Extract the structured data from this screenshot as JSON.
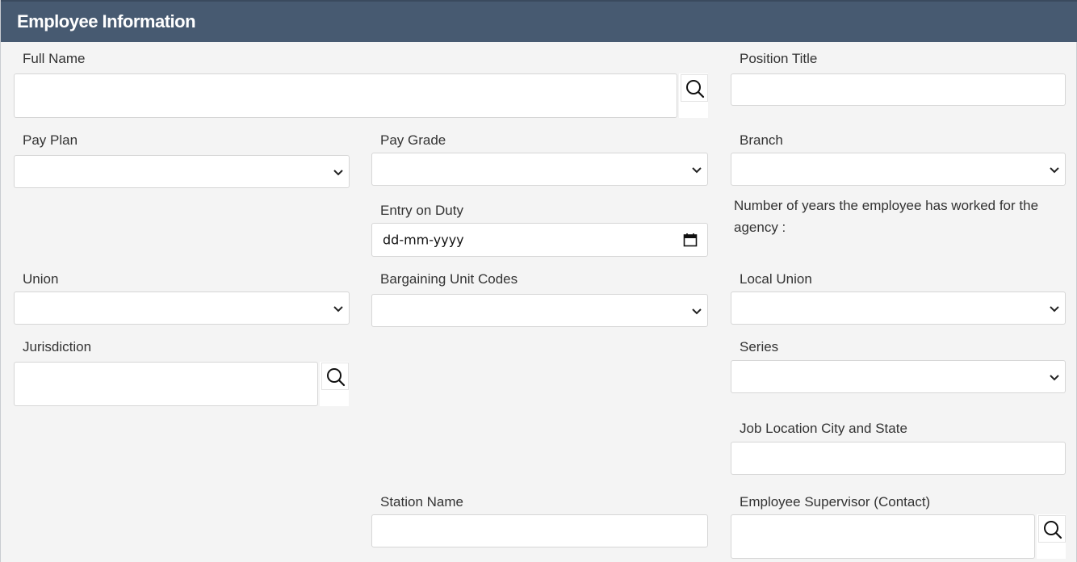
{
  "header": {
    "title": "Employee Information"
  },
  "labels": {
    "full_name": "Full Name",
    "position_title": "Position Title",
    "pay_plan": "Pay Plan",
    "pay_grade": "Pay Grade",
    "branch": "Branch",
    "entry_on_duty": "Entry on Duty",
    "years_worked": "Number of years the employee has worked for the agency :",
    "union": "Union",
    "bargaining_unit_codes": "Bargaining Unit Codes",
    "local_union": "Local Union",
    "jurisdiction": "Jurisdiction",
    "series": "Series",
    "job_location": "Job Location City and State",
    "station_name": "Station Name",
    "employee_supervisor": "Employee Supervisor (Contact)"
  },
  "fields": {
    "entry_on_duty_placeholder": "dd-mm-yyyy"
  },
  "icons": {
    "lookup": "search-icon",
    "dropdown": "chevron-down-icon",
    "date": "calendar-icon"
  },
  "colors": {
    "header_bg": "#475a71",
    "panel_bg": "#f4f4f4",
    "field_bg": "#ffffff"
  }
}
